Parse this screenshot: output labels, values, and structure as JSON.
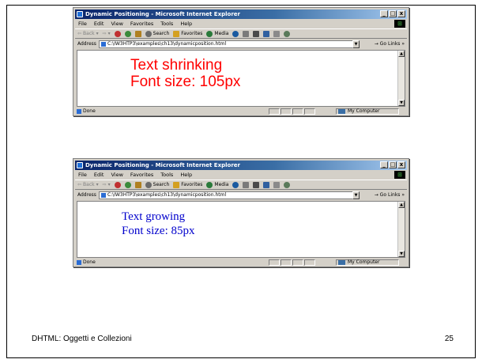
{
  "browser": {
    "title": "Dynamic Positioning - Microsoft Internet Explorer",
    "menu": [
      "File",
      "Edit",
      "View",
      "Favorites",
      "Tools",
      "Help"
    ],
    "toolbar": {
      "back": "Back",
      "search": "Search",
      "favorites": "Favorites",
      "media": "Media"
    },
    "address_label": "Address",
    "address_value": "C:\\IW3HTP3\\examples\\ch13\\dynamicposition.html",
    "go_label": "Go",
    "links_label": "Links",
    "status_text": "Done",
    "zone_text": "My Computer",
    "min_glyph": "_",
    "max_glyph": "□",
    "close_glyph": "x"
  },
  "windows": [
    {
      "line1": "Text shrinking",
      "line2": "Font size: 105px",
      "color": "#ff0000"
    },
    {
      "line1": "Text growing",
      "line2": "Font size: 85px",
      "color": "#0000cc"
    }
  ],
  "footer": {
    "title": "DHTML: Oggetti e Collezioni",
    "page_number": "25"
  },
  "icons": {
    "back": "back-arrow-icon",
    "forward": "forward-arrow-icon",
    "stop": "stop-icon",
    "refresh": "refresh-icon",
    "home": "home-icon",
    "search": "search-icon",
    "favorites": "favorites-icon",
    "media": "media-icon",
    "history": "history-icon",
    "mail": "mail-icon",
    "print": "print-icon",
    "edit": "edit-icon",
    "discuss": "discuss-icon",
    "messenger": "messenger-icon",
    "ie_logo": "windows-logo-icon",
    "page": "page-icon",
    "zone": "my-computer-icon"
  }
}
